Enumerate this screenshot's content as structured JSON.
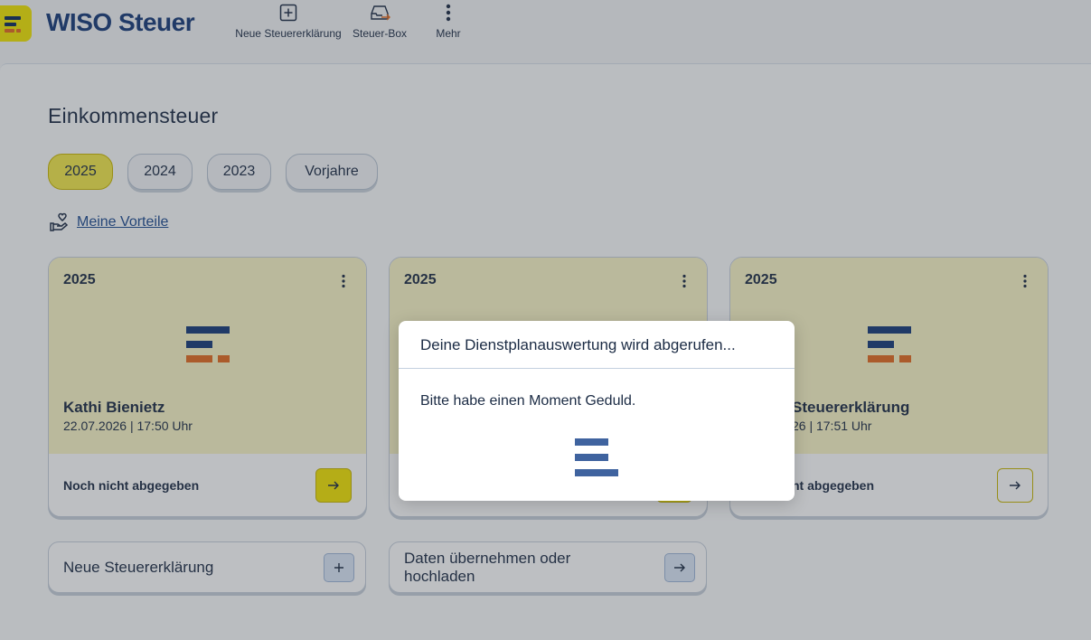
{
  "header": {
    "brand": "WISO Steuer",
    "nav": [
      {
        "label": "Neue Steuererklärung",
        "icon": "plus-square-icon"
      },
      {
        "label": "Steuer-Box",
        "icon": "inbox-arrow-icon"
      },
      {
        "label": "Mehr",
        "icon": "more-vertical-icon"
      }
    ]
  },
  "main": {
    "title": "Einkommensteuer",
    "years": [
      {
        "label": "2025",
        "active": true
      },
      {
        "label": "2024",
        "active": false
      },
      {
        "label": "2023",
        "active": false
      },
      {
        "label": "Vorjahre",
        "active": false
      }
    ],
    "vorteile_link": "Meine Vorteile",
    "cards": [
      {
        "year": "2025",
        "name": "Kathi Bienietz",
        "date": "22.07.2026 | 17:50 Uhr",
        "status": "Noch nicht abgegeben"
      },
      {
        "year": "2025",
        "name": "",
        "date": "",
        "status": ""
      },
      {
        "year": "2025",
        "name": "Steuererklärung",
        "date": "26 | 17:51 Uhr",
        "status": "ht abgegeben"
      }
    ],
    "actions": [
      {
        "label": "Neue Steuererklärung",
        "icon": "plus-icon"
      },
      {
        "label": "Daten übernehmen oder hochladen",
        "icon": "arrow-right-icon"
      }
    ]
  },
  "modal": {
    "title": "Deine Dienstplanauswertung wird abgerufen...",
    "body": "Bitte habe einen Moment Geduld."
  },
  "colors": {
    "brand_yellow": "#f3e500",
    "brand_blue": "#163a78",
    "brand_orange": "#e56b1f",
    "card_bg": "#fbf7c7"
  }
}
